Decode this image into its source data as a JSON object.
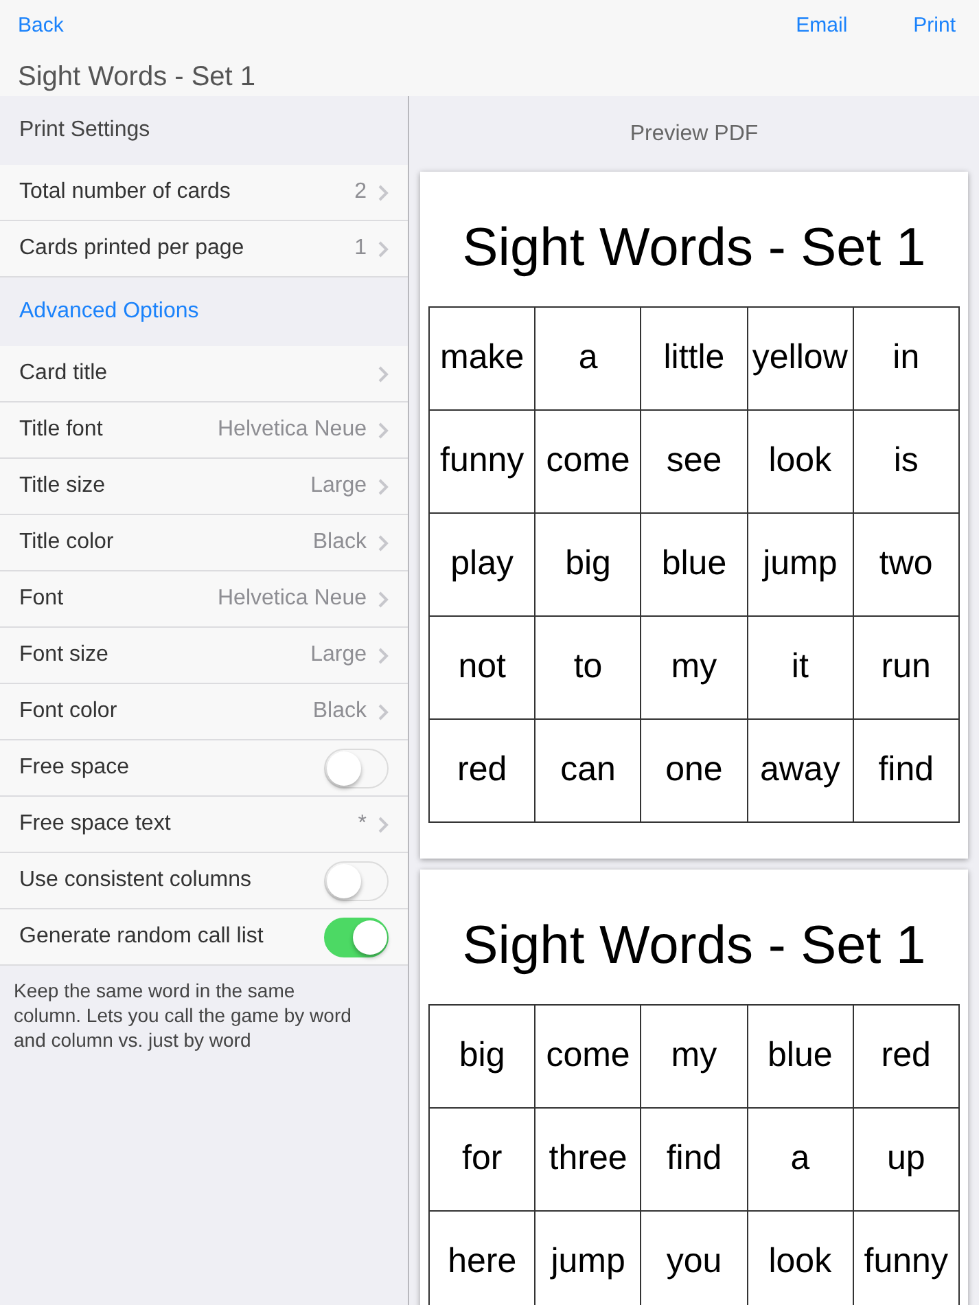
{
  "nav": {
    "back": "Back",
    "title": "Sight Words - Set 1",
    "actions": [
      "Email",
      "Print"
    ]
  },
  "settings": {
    "sections": [
      {
        "header": "Print Settings",
        "kind": "plain",
        "rows": [
          {
            "kind": "disclosure",
            "label": "Total number of cards",
            "value": "2"
          },
          {
            "kind": "disclosure",
            "label": "Cards printed per page",
            "value": "1"
          }
        ]
      },
      {
        "header": "Advanced Options",
        "kind": "link",
        "rows": [
          {
            "kind": "disclosure",
            "label": "Card title"
          },
          {
            "kind": "disclosure",
            "label": "Title font",
            "value": "Helvetica Neue"
          },
          {
            "kind": "disclosure",
            "label": "Title size",
            "value": "Large"
          },
          {
            "kind": "disclosure",
            "label": "Title color",
            "value": "Black"
          },
          {
            "kind": "disclosure",
            "label": "Font",
            "value": "Helvetica Neue"
          },
          {
            "kind": "disclosure",
            "label": "Font size",
            "value": "Large"
          },
          {
            "kind": "disclosure",
            "label": "Font color",
            "value": "Black"
          },
          {
            "kind": "toggle",
            "label": "Free space",
            "on": false
          },
          {
            "kind": "disclosure",
            "label": "Free space text",
            "value": "*"
          },
          {
            "kind": "toggle",
            "label": "Use consistent columns",
            "on": false
          },
          {
            "kind": "toggle",
            "label": "Generate random call list",
            "on": true
          }
        ]
      }
    ],
    "footer": "Keep the same word in the same column. Lets you call the game by word and column vs. just by word"
  },
  "preview": {
    "title": "Preview PDF",
    "cards": [
      {
        "title": "Sight Words - Set 1",
        "rows": [
          [
            "make",
            "a",
            "little",
            "yellow",
            "in"
          ],
          [
            "funny",
            "come",
            "see",
            "look",
            "is"
          ],
          [
            "play",
            "big",
            "blue",
            "jump",
            "two"
          ],
          [
            "not",
            "to",
            "my",
            "it",
            "run"
          ],
          [
            "red",
            "can",
            "one",
            "away",
            "find"
          ]
        ]
      },
      {
        "title": "Sight Words - Set 1",
        "rows": [
          [
            "big",
            "come",
            "my",
            "blue",
            "red"
          ],
          [
            "for",
            "three",
            "find",
            "a",
            "up"
          ],
          [
            "here",
            "jump",
            "you",
            "look",
            "funny"
          ]
        ]
      }
    ]
  }
}
